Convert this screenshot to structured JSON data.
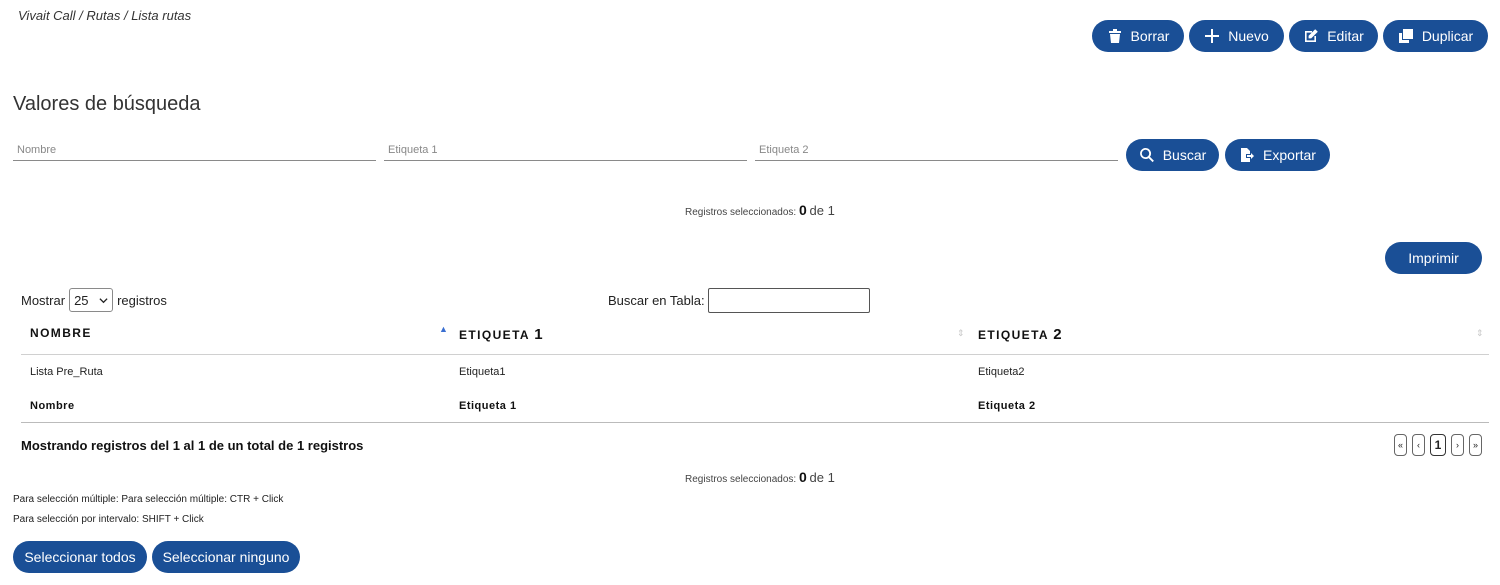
{
  "breadcrumb": "Vivait Call / Rutas / Lista rutas",
  "toolbar": {
    "delete_label": "Borrar",
    "new_label": "Nuevo",
    "edit_label": "Editar",
    "duplicate_label": "Duplicar"
  },
  "search": {
    "title": "Valores de búsqueda",
    "name_placeholder": "Nombre",
    "tag1_placeholder": "Etiqueta 1",
    "tag2_placeholder": "Etiqueta 2",
    "search_label": "Buscar",
    "export_label": "Exportar"
  },
  "selection_top": {
    "label": "Registros seleccionados:",
    "count": "0",
    "of_label": "de 1"
  },
  "print_label": "Imprimir",
  "table_controls": {
    "show_label": "Mostrar",
    "page_size": "25",
    "records_label": "registros",
    "table_search_label": "Buscar en Tabla:"
  },
  "table": {
    "headers": [
      {
        "main": "NOMBRE",
        "suffix": ""
      },
      {
        "main": "ETIQUETA",
        "suffix": "1"
      },
      {
        "main": "ETIQUETA",
        "suffix": "2"
      }
    ],
    "rows": [
      [
        "Lista Pre_Ruta",
        "Etiqueta1",
        "Etiqueta2"
      ]
    ],
    "footers": [
      "Nombre",
      "Etiqueta 1",
      "Etiqueta 2"
    ]
  },
  "info": "Mostrando registros del 1 al 1 de un total de 1 registros",
  "pagination": {
    "first": "«",
    "prev": "‹",
    "current": "1",
    "next": "›",
    "last": "»"
  },
  "selection_bottom": {
    "label": "Registros seleccionados:",
    "count": "0",
    "of_label": "de 1"
  },
  "help": {
    "multi": "Para selección múltiple: Para selección múltiple: CTR + Click",
    "interval": "Para selección por intervalo: SHIFT + Click"
  },
  "select_all_label": "Seleccionar todos",
  "select_none_label": "Seleccionar ninguno",
  "colors": {
    "primary": "#1a4f96",
    "sort_active": "#3a6fd1"
  }
}
